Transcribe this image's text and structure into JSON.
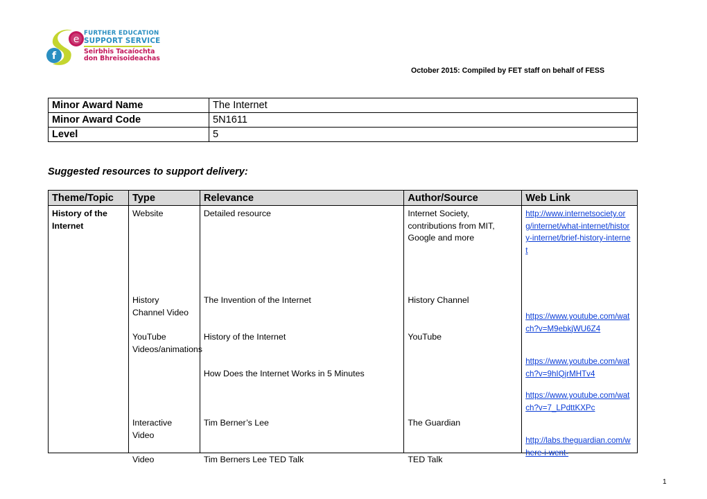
{
  "logo": {
    "alt": "FESS logo",
    "line1": "FURTHER EDUCATION",
    "line2": "SUPPORT SERVICE",
    "line3": "Seirbhis Tacaíochta",
    "line4": "don Bhreisoideachas",
    "letters": [
      "f",
      "s",
      "e"
    ],
    "colors": {
      "blue": "#2a8fc1",
      "green": "#c4d52f",
      "pink": "#c2185b"
    }
  },
  "header": {
    "compiled": "October 2015: Compiled by FET staff on behalf of FESS"
  },
  "award": {
    "rows": [
      {
        "label": "Minor Award Name",
        "value": "The Internet"
      },
      {
        "label": "Minor Award Code",
        "value": "5N1611"
      },
      {
        "label": "Level",
        "value": "5"
      }
    ]
  },
  "subtitle": "Suggested resources to support delivery:",
  "resources": {
    "headers": [
      "Theme/Topic",
      "Type",
      "Relevance",
      "Author/Source",
      "Web Link"
    ],
    "theme": "History of the Internet",
    "entries": [
      {
        "type": "Website",
        "relevance": "Detailed resource",
        "author": "Internet Society, contributions from MIT, Google and more",
        "link": "http://www.internetsociety.org/internet/what-internet/history-internet/brief-history-internet"
      },
      {
        "type": "History Channel Video",
        "relevance": "The Invention of the Internet",
        "author": "History Channel",
        "link": "https://www.youtube.com/watch?v=M9ebkjWU6Z4"
      },
      {
        "type": "YouTube Videos/animations",
        "relevance": "History of the Internet",
        "author": "YouTube",
        "link": "https://www.youtube.com/watch?v=9hIQjrMHTv4"
      },
      {
        "type": "",
        "relevance": "How Does the Internet Works in 5 Minutes",
        "author": "",
        "link": "https://www.youtube.com/watch?v=7_LPdttKXPc"
      },
      {
        "type": "Interactive Video",
        "relevance": "Tim Berner’s Lee",
        "author": "The Guardian",
        "link": "http://labs.theguardian.com/where-i-went-"
      },
      {
        "type": "Video",
        "relevance": "Tim  Berners Lee TED Talk",
        "author": "TED Talk",
        "link": ""
      }
    ],
    "link_color": "#0a3cd6",
    "header_bg": "#d9d9d9"
  },
  "page_number": "1"
}
